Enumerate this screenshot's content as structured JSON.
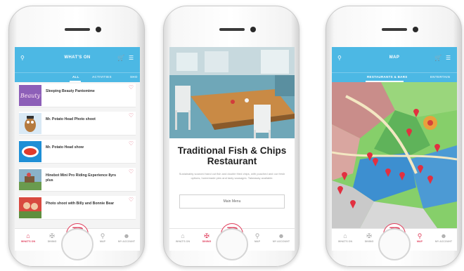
{
  "phones": [
    {
      "header": {
        "title": "WHAT'S ON"
      },
      "tabs": [
        "ALL",
        "ACTIVITIES",
        "SHO"
      ],
      "events": [
        {
          "title": "Sleeping Beauty Pantomime",
          "thumb_color": "#8d5fb8"
        },
        {
          "title": "Mr. Potato Head Photo shoot",
          "thumb_color": "#d9e9f5"
        },
        {
          "title": "Mr. Potato Head show",
          "thumb_color": "#1e8fd6"
        },
        {
          "title": "Hinebot Mini Pro Riding Experience 8yrs plus",
          "thumb_color": "#8ab2c9"
        },
        {
          "title": "Photo shoot with Billy and Bonnie Bear",
          "thumb_color": "#d8493f"
        }
      ],
      "nav": [
        "WHAT'S ON",
        "DINING",
        "MAP",
        "MY ACCOUNT"
      ]
    },
    {
      "restaurant": {
        "title": "Traditional Fish & Chips Restaurant",
        "description": "Sustainably sourced hand cut fish and double fried chips, with poached and our fresh options, homemade pies and tasty sausages. Takeaway available.",
        "button": "Main Menu"
      },
      "nav": [
        "WHAT'S ON",
        "DINING",
        "MAP",
        "MY ACCOUNT"
      ]
    },
    {
      "header": {
        "title": "MAP"
      },
      "tabs": [
        "RESTAURANTS & BARS",
        "ENTERTAIN"
      ],
      "nav": [
        "WHAT'S ON",
        "DINING",
        "MAP",
        "MY ACCOUNT"
      ]
    }
  ],
  "brand_logo": "B",
  "colors": {
    "header": "#4cb8e4",
    "accent": "#e0405e",
    "heart": "#e0627a"
  },
  "icons": [
    "search-icon",
    "cart-icon",
    "menu-icon",
    "heart-icon",
    "home-icon",
    "dining-icon",
    "map-icon",
    "account-icon"
  ]
}
